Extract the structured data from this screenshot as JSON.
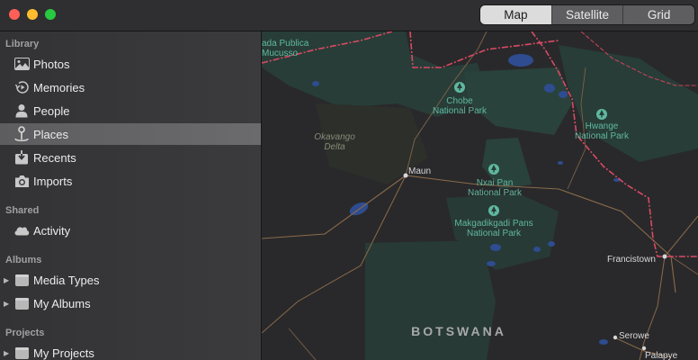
{
  "toolbar": {
    "segments": [
      {
        "label": "Map",
        "active": true
      },
      {
        "label": "Satellite",
        "active": false
      },
      {
        "label": "Grid",
        "active": false
      }
    ]
  },
  "sidebar": {
    "library_header": "Library",
    "library": [
      {
        "label": "Photos",
        "icon": "photos-icon"
      },
      {
        "label": "Memories",
        "icon": "memories-icon"
      },
      {
        "label": "People",
        "icon": "people-icon"
      },
      {
        "label": "Places",
        "icon": "places-icon",
        "selected": true
      },
      {
        "label": "Recents",
        "icon": "recents-icon"
      },
      {
        "label": "Imports",
        "icon": "imports-icon"
      }
    ],
    "shared_header": "Shared",
    "shared": [
      {
        "label": "Activity",
        "icon": "cloud-icon"
      }
    ],
    "albums_header": "Albums",
    "albums": [
      {
        "label": "Media Types",
        "icon": "folder-icon"
      },
      {
        "label": "My Albums",
        "icon": "folder-icon"
      }
    ],
    "projects_header": "Projects",
    "projects": [
      {
        "label": "My Projects",
        "icon": "folder-icon"
      }
    ]
  },
  "map": {
    "colors": {
      "land": "#29292b",
      "park": "#283d38",
      "water": "#2e4c8f",
      "border": "#d94a64",
      "road": "#8a6a4a",
      "park_label": "#5fb8a0"
    },
    "labels": {
      "mucusso_1": "ada Publica",
      "mucusso_2": "Mucusso",
      "okavango_1": "Okavango",
      "okavango_2": "Delta",
      "chobe_1": "Chobe",
      "chobe_2": "National Park",
      "hwange_1": "Hwange",
      "hwange_2": "National Park",
      "nxai_1": "Nxai Pan",
      "nxai_2": "National Park",
      "makgadi_1": "Makgadikgadi Pans",
      "makgadi_2": "National Park",
      "maun": "Maun",
      "francistown": "Francistown",
      "serowe": "Serowe",
      "palapye": "Palapye",
      "botswana": "BOTSWANA"
    }
  }
}
